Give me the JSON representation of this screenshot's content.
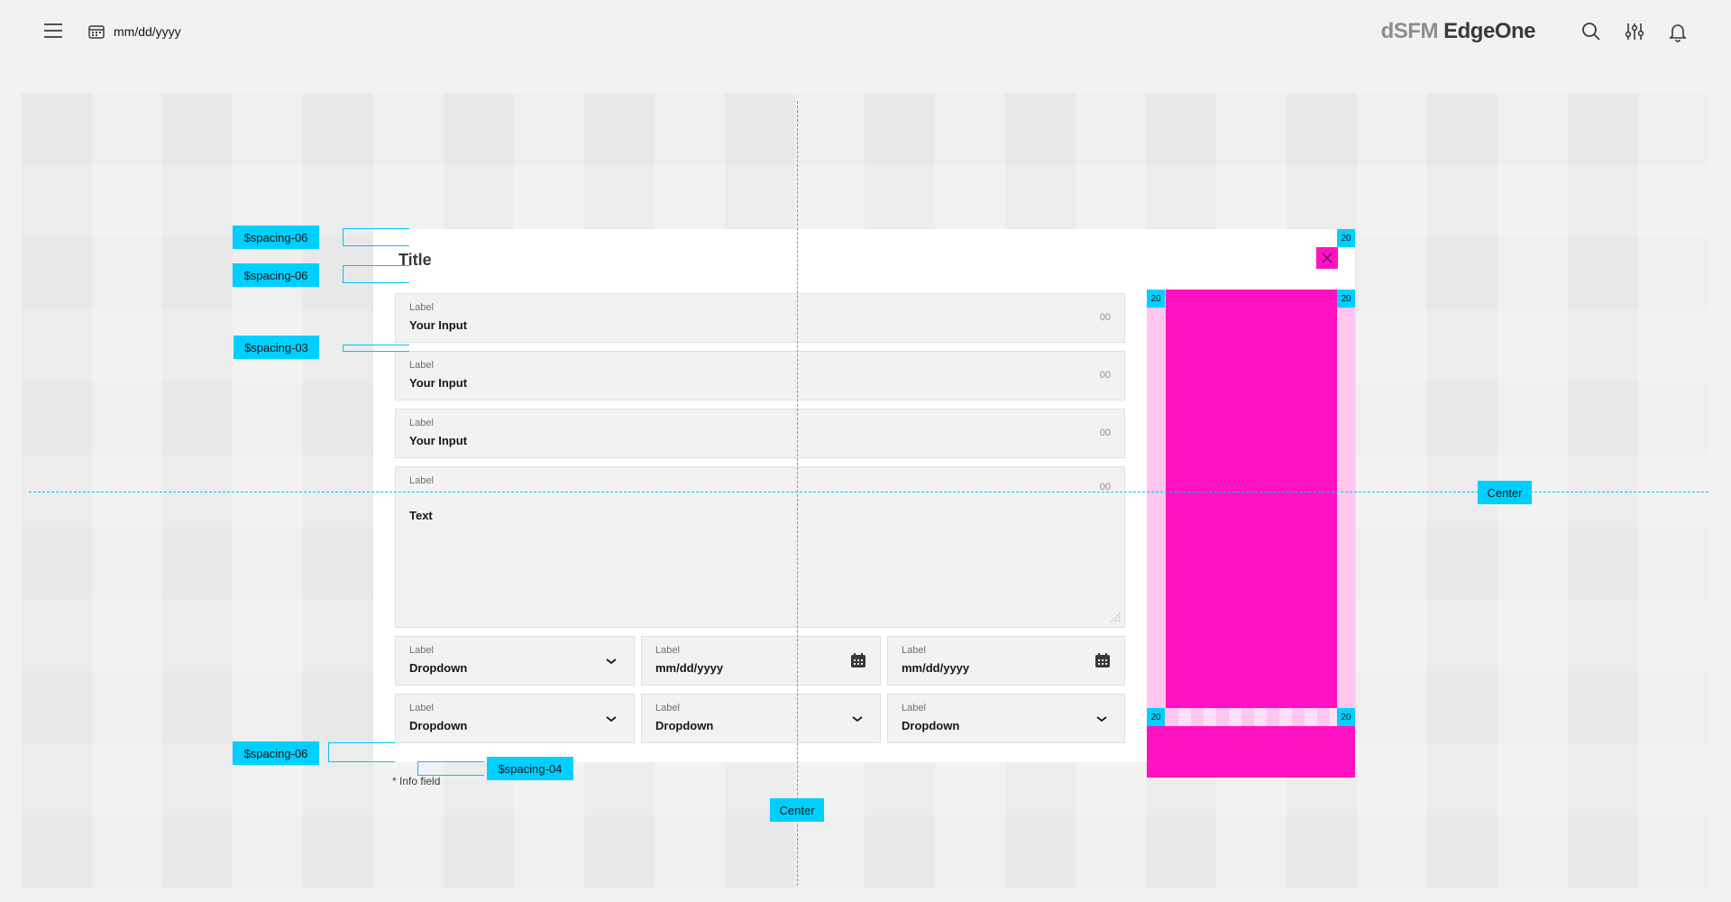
{
  "header": {
    "menu_icon": "hamburger-menu-icon",
    "date_placeholder": "mm/dd/yyyy",
    "brand_prefix": "dSFM",
    "brand_suffix": " EdgeOne",
    "icons": [
      "search-icon",
      "filter-sliders-icon",
      "notification-bell-icon"
    ]
  },
  "modal": {
    "title": "Title",
    "inputs": [
      {
        "label": "Label",
        "value": "Your Input",
        "counter": "00"
      },
      {
        "label": "Label",
        "value": "Your Input",
        "counter": "00"
      },
      {
        "label": "Label",
        "value": "Your Input",
        "counter": "00"
      }
    ],
    "textarea": {
      "label": "Label",
      "value": "Text",
      "counter": "00"
    },
    "row1": [
      {
        "label": "Label",
        "value": "Dropdown",
        "kind": "dropdown"
      },
      {
        "label": "Label",
        "value": "mm/dd/yyyy",
        "kind": "date"
      },
      {
        "label": "Label",
        "value": "mm/dd/yyyy",
        "kind": "date"
      }
    ],
    "row2": [
      {
        "label": "Label",
        "value": "Dropdown",
        "kind": "dropdown"
      },
      {
        "label": "Label",
        "value": "Dropdown",
        "kind": "dropdown"
      },
      {
        "label": "Label",
        "value": "Dropdown",
        "kind": "dropdown"
      }
    ],
    "info_note": "* Info field",
    "close_icon": "close-icon"
  },
  "side_panel": {
    "badges": [
      "20",
      "20",
      "20",
      "20",
      "20"
    ]
  },
  "annotations": {
    "spacing_06": "$spacing-06",
    "spacing_03": "$spacing-03",
    "spacing_04": "$spacing-04",
    "center": "Center"
  },
  "colors": {
    "accent_cyan": "#00cfff",
    "accent_magenta": "#ff12c2",
    "magenta_light": "#ffc6ef",
    "field_bg": "#f2f2f2"
  }
}
